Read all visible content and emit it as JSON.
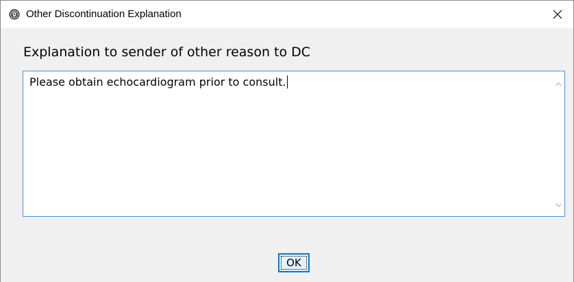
{
  "window": {
    "title": "Other Discontinuation Explanation",
    "app_icon": "va-seal-icon",
    "close_icon": "close-icon"
  },
  "dialog": {
    "prompt": "Explanation to sender of other reason to DC",
    "text_value": "Please obtain echocardiogram prior to consult.",
    "scroll_up_icon": "chevron-up-icon",
    "scroll_down_icon": "chevron-down-icon",
    "ok_label": "OK"
  },
  "colors": {
    "titlebar_bg": "#ffffff",
    "dialog_bg": "#f0f0f0",
    "focus_border": "#4a8fd0",
    "button_accent": "#0078d7"
  }
}
